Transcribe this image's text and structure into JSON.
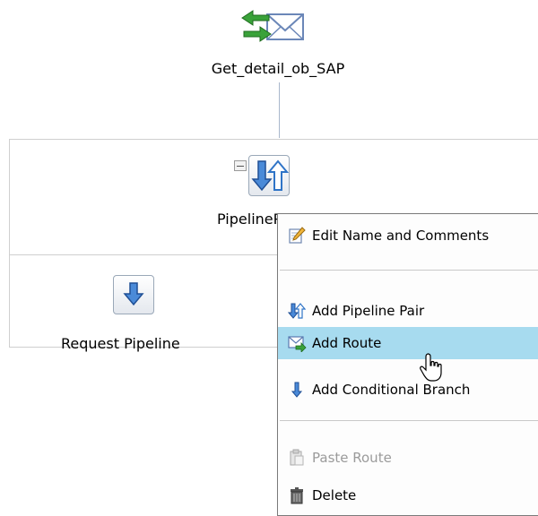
{
  "proxy": {
    "label": "Get_detail_ob_SAP",
    "icon": "proxy-service-icon"
  },
  "pipeline_pair": {
    "label": "PipelineP",
    "icon": "pipeline-pair-icon",
    "collapse_icon": "collapse-icon"
  },
  "request_pipeline": {
    "label": "Request Pipeline",
    "icon": "request-pipeline-icon"
  },
  "context_menu": {
    "items": [
      {
        "label": "Edit Name and Comments",
        "icon": "edit-icon",
        "enabled": true
      },
      {
        "label": "Add Pipeline Pair",
        "icon": "pipeline-pair-icon",
        "enabled": true
      },
      {
        "label": "Add Route",
        "icon": "route-icon",
        "enabled": true,
        "highlighted": true
      },
      {
        "label": "Add Conditional Branch",
        "icon": "branch-icon",
        "enabled": true
      },
      {
        "label": "Paste Route",
        "icon": "paste-icon",
        "enabled": false
      },
      {
        "label": "Delete",
        "icon": "trash-icon",
        "enabled": true
      }
    ]
  },
  "colors": {
    "highlight": "#a7dbef",
    "connector": "#a9b7cc",
    "arrow_blue": "#2f74c7",
    "arrow_green": "#2e9d2e"
  }
}
